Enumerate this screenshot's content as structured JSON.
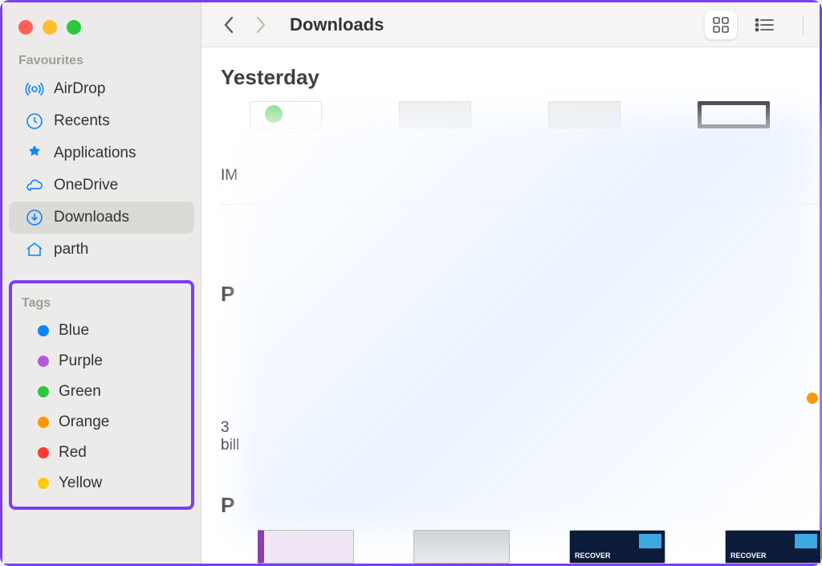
{
  "window": {
    "title": "Downloads"
  },
  "sidebar": {
    "favourites_label": "Favourites",
    "favourites": [
      {
        "icon": "airdrop",
        "label": "AirDrop",
        "selected": false
      },
      {
        "icon": "recents",
        "label": "Recents",
        "selected": false
      },
      {
        "icon": "applications",
        "label": "Applications",
        "selected": false
      },
      {
        "icon": "onedrive",
        "label": "OneDrive",
        "selected": false
      },
      {
        "icon": "downloads",
        "label": "Downloads",
        "selected": true
      },
      {
        "icon": "home",
        "label": "parth",
        "selected": false
      }
    ],
    "tags_label": "Tags",
    "tags": [
      {
        "label": "Blue",
        "color": "#0b84ff"
      },
      {
        "label": "Purple",
        "color": "#b757e0"
      },
      {
        "label": "Green",
        "color": "#28c940"
      },
      {
        "label": "Orange",
        "color": "#ff9500"
      },
      {
        "label": "Red",
        "color": "#ff3b30"
      },
      {
        "label": "Yellow",
        "color": "#ffcc00"
      }
    ]
  },
  "toolbar": {
    "back_enabled": true,
    "forward_enabled": false,
    "view_mode": "icon"
  },
  "content": {
    "groups": [
      {
        "header": "Yesterday"
      }
    ],
    "visible_text_fragments": {
      "file1_prefix": "IM",
      "section2_initial": "P",
      "mid_number": "3",
      "mid_word": "bill",
      "section3_initial": "P"
    },
    "bottom_thumbs": [
      {
        "type": "light"
      },
      {
        "type": "light"
      },
      {
        "type": "dark",
        "label": "RECOVER"
      },
      {
        "type": "dark",
        "label": "RECOVER"
      }
    ]
  }
}
